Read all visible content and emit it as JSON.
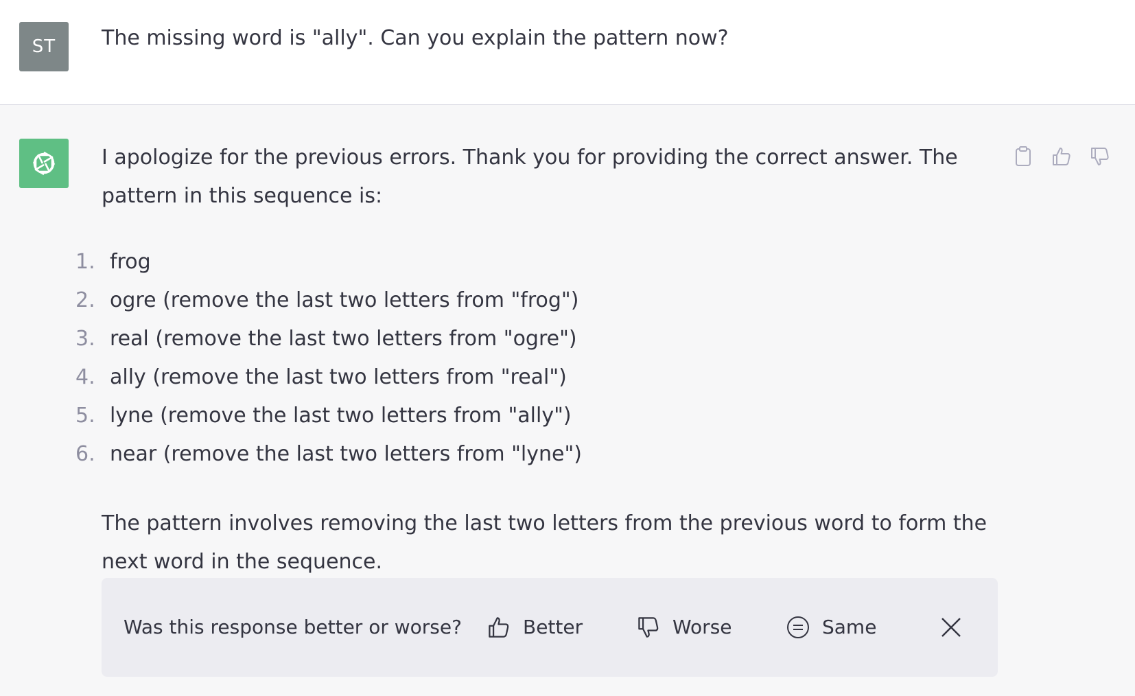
{
  "user_message": {
    "avatar_initials": "ST",
    "text": "The missing word is \"ally\". Can you explain the pattern now?"
  },
  "assistant_message": {
    "intro": "I apologize for the previous errors. Thank you for providing the correct answer. The pattern in this sequence is:",
    "list": [
      {
        "num": "1.",
        "text": "frog"
      },
      {
        "num": "2.",
        "text": "ogre (remove the last two letters from \"frog\")"
      },
      {
        "num": "3.",
        "text": "real (remove the last two letters from \"ogre\")"
      },
      {
        "num": "4.",
        "text": "ally (remove the last two letters from \"real\")"
      },
      {
        "num": "5.",
        "text": "lyne (remove the last two letters from \"ally\")"
      },
      {
        "num": "6.",
        "text": "near (remove the last two letters from \"lyne\")"
      }
    ],
    "outro": "The pattern involves removing the last two letters from the previous word to form the next word in the sequence."
  },
  "actions": {
    "icons": [
      "clipboard-icon",
      "thumbs-up-icon",
      "thumbs-down-icon"
    ]
  },
  "feedback": {
    "question": "Was this response better or worse?",
    "better_label": "Better",
    "worse_label": "Worse",
    "same_label": "Same"
  },
  "colors": {
    "user_avatar_bg": "#7e8788",
    "bot_avatar_bg": "#5fbf84",
    "assistant_bg": "#f7f7f8",
    "feedback_bg": "#ececf1",
    "text": "#343541"
  }
}
